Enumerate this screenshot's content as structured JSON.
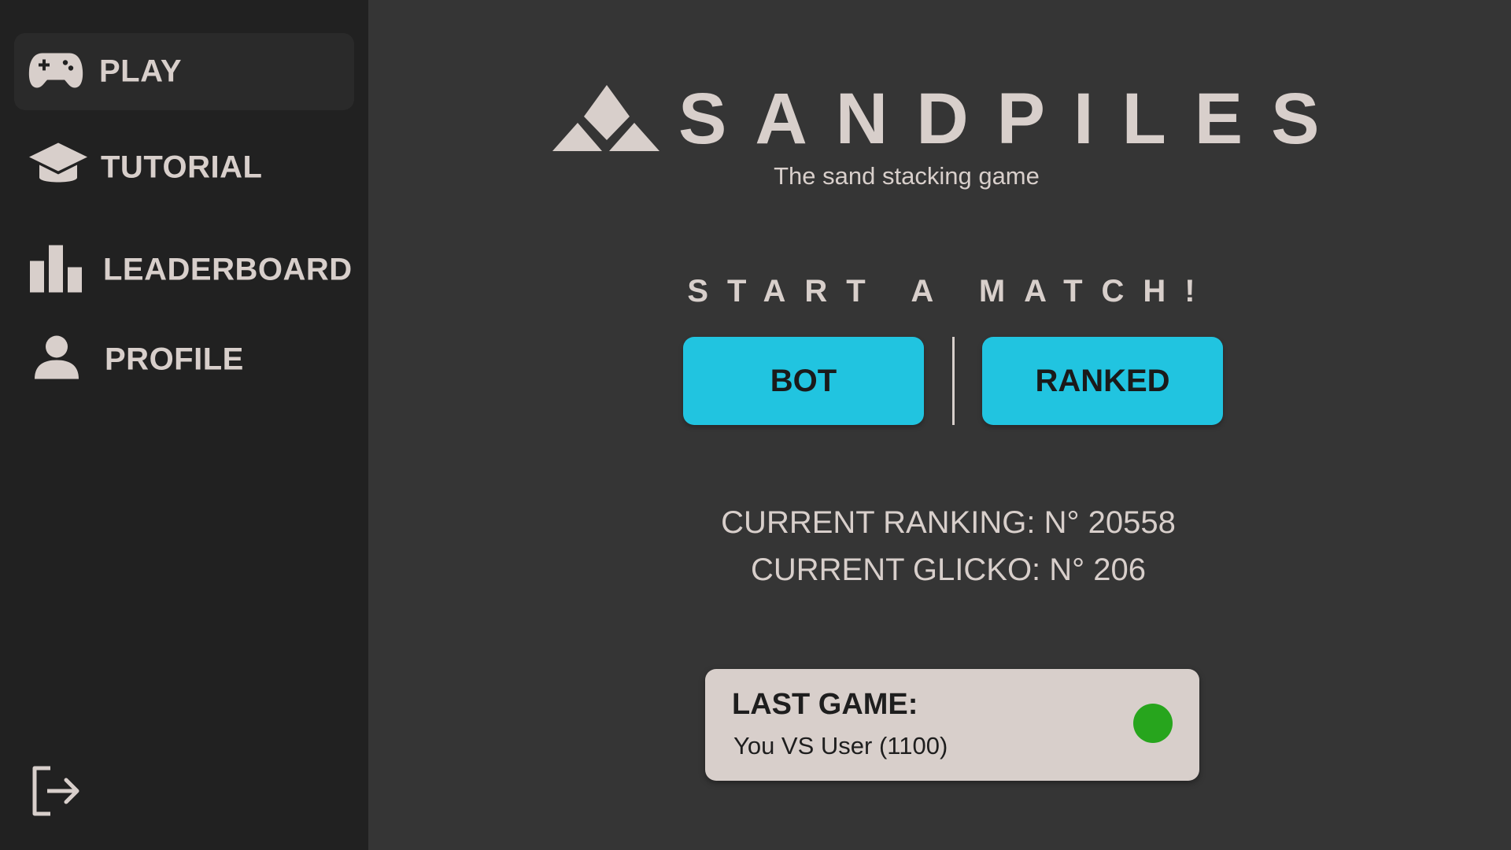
{
  "sidebar": {
    "items": [
      {
        "label": "PLAY",
        "icon": "gamepad-icon",
        "active": true
      },
      {
        "label": "TUTORIAL",
        "icon": "graduation-cap-icon",
        "active": false
      },
      {
        "label": "LEADERBOARD",
        "icon": "bar-chart-icon",
        "active": false
      },
      {
        "label": "PROFILE",
        "icon": "user-icon",
        "active": false
      }
    ],
    "logout_icon": "logout-icon"
  },
  "header": {
    "title": "SANDPILES",
    "subtitle": "The sand stacking game",
    "logo_icon": "sandpile-logo-icon"
  },
  "match": {
    "heading": "START A MATCH!",
    "bot_label": "BOT",
    "ranked_label": "RANKED"
  },
  "stats": {
    "ranking": "CURRENT RANKING: N° 20558",
    "glicko": "CURRENT GLICKO: N° 206"
  },
  "last_game": {
    "title": "LAST GAME:",
    "detail": "You VS User (1100)",
    "status_icon": "result-dot-icon"
  },
  "colors": {
    "background": "#353535",
    "sidebar": "#212121",
    "accent": "#21c4e0",
    "text": "#d8cfcb",
    "win": "#27a51d"
  }
}
